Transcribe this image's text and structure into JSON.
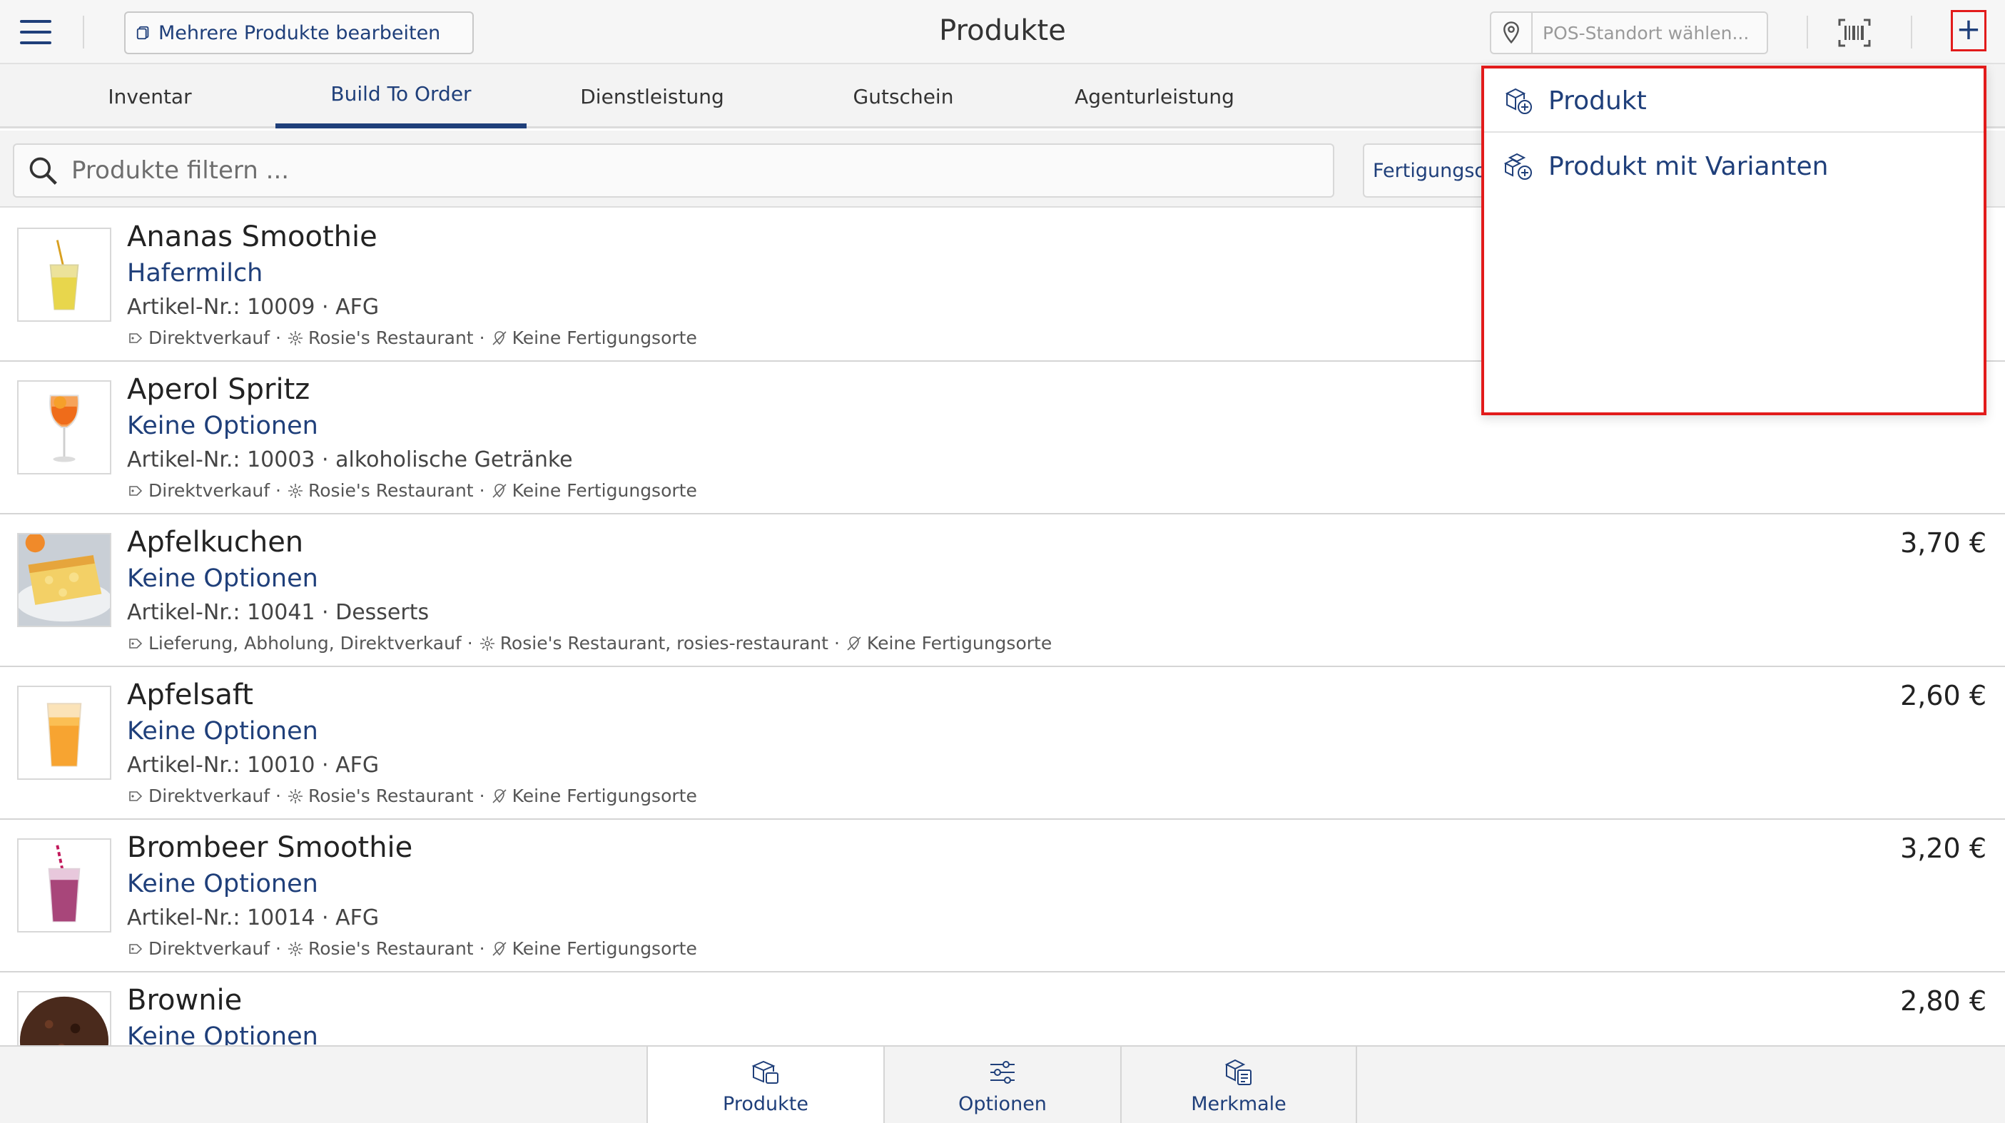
{
  "header": {
    "multi_edit_label": "Mehrere Produkte bearbeiten",
    "title": "Produkte",
    "pos_placeholder": "POS-Standort wählen...",
    "add_label": "+"
  },
  "tabs": [
    {
      "label": "Inventar",
      "active": false
    },
    {
      "label": "Build To Order",
      "active": true
    },
    {
      "label": "Dienstleistung",
      "active": false
    },
    {
      "label": "Gutschein",
      "active": false
    },
    {
      "label": "Agenturleistung",
      "active": false
    }
  ],
  "filter": {
    "placeholder": "Produkte filtern ...",
    "fertigung_label": "Fertigungsorte"
  },
  "dropdown": {
    "items": [
      {
        "label": "Produkt",
        "icon": "product-add-icon"
      },
      {
        "label": "Produkt mit Varianten",
        "icon": "product-variants-add-icon"
      }
    ]
  },
  "products": [
    {
      "name": "Ananas Smoothie",
      "options": "Hafermilch",
      "article": "Artikel-Nr.: 10009 · AFG",
      "channels": "Direktverkauf",
      "locations": "Rosie's Restaurant",
      "production": "Keine Fertigungsorte",
      "price": "",
      "image": "yellow-smoothie"
    },
    {
      "name": "Aperol Spritz",
      "options": "Keine Optionen",
      "article": "Artikel-Nr.: 10003 · alkoholische Getränke",
      "channels": "Direktverkauf",
      "locations": "Rosie's Restaurant",
      "production": "Keine Fertigungsorte",
      "price": "",
      "image": "aperol-glass"
    },
    {
      "name": "Apfelkuchen",
      "options": "Keine Optionen",
      "article": "Artikel-Nr.: 10041 · Desserts",
      "channels": "Lieferung, Abholung, Direktverkauf",
      "locations": "Rosie's Restaurant, rosies-restaurant",
      "production": "Keine Fertigungsorte",
      "price": "3,70 €",
      "image": "apple-cake"
    },
    {
      "name": "Apfelsaft",
      "options": "Keine Optionen",
      "article": "Artikel-Nr.: 10010 · AFG",
      "channels": "Direktverkauf",
      "locations": "Rosie's Restaurant",
      "production": "Keine Fertigungsorte",
      "price": "2,60 €",
      "image": "apple-juice"
    },
    {
      "name": "Brombeer Smoothie",
      "options": "Keine Optionen",
      "article": "Artikel-Nr.: 10014 · AFG",
      "channels": "Direktverkauf",
      "locations": "Rosie's Restaurant",
      "production": "Keine Fertigungsorte",
      "price": "3,20 €",
      "image": "berry-smoothie"
    },
    {
      "name": "Brownie",
      "options": "Keine Optionen",
      "article": "",
      "channels": "",
      "locations": "",
      "production": "",
      "price": "2,80 €",
      "image": "brownie"
    }
  ],
  "bottom_nav": [
    {
      "label": "Produkte",
      "active": true,
      "icon": "products-icon"
    },
    {
      "label": "Optionen",
      "active": false,
      "icon": "sliders-icon"
    },
    {
      "label": "Merkmale",
      "active": false,
      "icon": "attributes-icon"
    }
  ],
  "colors": {
    "accent": "#1f3f7a",
    "highlight": "#e21b1b"
  }
}
